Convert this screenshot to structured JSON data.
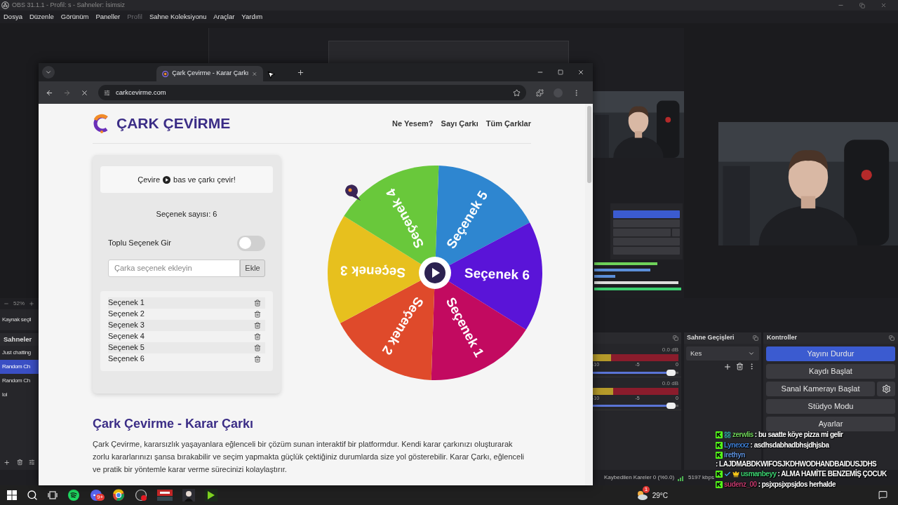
{
  "obs": {
    "title": "OBS 31.1.1 - Profil: s - Sahneler: İsimsiz",
    "menu": [
      {
        "label": "Dosya",
        "disabled": false
      },
      {
        "label": "Düzenle",
        "disabled": false
      },
      {
        "label": "Görünüm",
        "disabled": false
      },
      {
        "label": "Paneller",
        "disabled": false
      },
      {
        "label": "Profil",
        "disabled": true
      },
      {
        "label": "Sahne Koleksiyonu",
        "disabled": false
      },
      {
        "label": "Araçlar",
        "disabled": false
      },
      {
        "label": "Yardım",
        "disabled": false
      }
    ],
    "zoom": "52%",
    "source_hint": "Kaynak seçil",
    "scenes": {
      "title": "Sahneler",
      "items": [
        {
          "label": "Just chatting",
          "selected": false
        },
        {
          "label": "Random Ch",
          "selected": true
        },
        {
          "label": "Random Ch",
          "selected": false
        },
        {
          "label": "lol",
          "selected": false
        }
      ]
    },
    "mixer": {
      "channels": [
        {
          "reading": "0.0 dB",
          "meter": {
            "level": 0.22
          },
          "level": 0.97,
          "ticks": [
            "-10",
            "-5",
            "0"
          ]
        },
        {
          "reading": "0.0 dB",
          "meter": {
            "level": 0.24
          },
          "level": 0.97,
          "ticks": [
            "-10",
            "-5",
            "0"
          ]
        }
      ]
    },
    "transitions": {
      "title": "Sahne Geçişleri",
      "value": "Kes"
    },
    "controls": {
      "title": "Kontroller",
      "buttons": [
        {
          "label": "Yayını Durdur",
          "active": true,
          "kind": "plain"
        },
        {
          "label": "Kaydı Başlat",
          "active": false,
          "kind": "plain"
        },
        {
          "label": "Sanal Kamerayı Başlat",
          "active": false,
          "kind": "settings"
        },
        {
          "label": "Stüdyo Modu",
          "active": false,
          "kind": "plain"
        },
        {
          "label": "Ayarlar",
          "active": false,
          "kind": "plain"
        }
      ]
    },
    "status_bar": {
      "dropped": "Kaybedilen Kareler 0 (%0.0)",
      "bitrate": "5197 kbps"
    }
  },
  "browser": {
    "tab_title": "Çark Çevirme - Karar Çarkı",
    "url": "carkcevirme.com"
  },
  "page": {
    "logo": "ÇARK ÇEVİRME",
    "nav": [
      "Ne Yesem?",
      "Sayı Çarkı",
      "Tüm Çarklar"
    ],
    "instruction_before": "Çevire",
    "instruction_after": "bas ve çarkı çevir!",
    "count": "Seçenek sayısı: 6",
    "bulk": {
      "label": "Toplu Seçenek Gir",
      "on": false
    },
    "input": {
      "placeholder": "Çarka seçenek ekleyin"
    },
    "add_button": "Ekle",
    "options": [
      "Seçenek 1",
      "Seçenek 2",
      "Seçenek 3",
      "Seçenek 4",
      "Seçenek 5",
      "Seçenek 6"
    ],
    "wheel": {
      "segments": [
        {
          "label": "Seçenek 5",
          "color": "#2e86d0"
        },
        {
          "label": "Seçenek 6",
          "color": "#5a14d8"
        },
        {
          "label": "Seçenek 1",
          "color": "#c20a60"
        },
        {
          "label": "Seçenek 2",
          "color": "#df4a2b"
        },
        {
          "label": "Seçenek 3",
          "color": "#e7c01e"
        },
        {
          "label": "Seçenek 4",
          "color": "#69c83b"
        }
      ]
    },
    "heading": "Çark Çevirme - Karar Çarkı",
    "paragraph": "Çark Çevirme, kararsızlık yaşayanlara eğlenceli bir çözüm sunan interaktif bir platformdur. Kendi karar çarkınızı oluşturarak zorlu kararlarınızı şansa bırakabilir ve seçim yapmakta güçlük çektiğiniz durumlarda size yol gösterebilir. Karar Çarkı, eğlenceli ve pratik bir yöntemle karar verme sürecinizi kolaylaştırır."
  },
  "chat": [
    {
      "name": "zerwlis",
      "color": "#6fd35a",
      "badges": [
        {
          "kind": "kick"
        },
        {
          "kind": "sub"
        }
      ],
      "message": ": bu saatte köye pizza mi gelir"
    },
    {
      "name": "Lynexxz",
      "color": "#3d7fd6",
      "badges": [
        {
          "kind": "kick"
        }
      ],
      "message": ": asdhsdabhadbhsjdhjsba"
    },
    {
      "name": "irethyn",
      "color": "#5b8ed8",
      "badges": [
        {
          "kind": "kick"
        }
      ],
      "message": ": LAJDMABDKWIFOSJKDHWODHANDBAIDUSJDHS"
    },
    {
      "name": "usmanbeyy",
      "color": "#3cd070",
      "badges": [
        {
          "kind": "kick"
        },
        {
          "kind": "verified"
        },
        {
          "kind": "crown"
        }
      ],
      "message": ": ALMA HAMİTE BENZEMİŞ ÇOCUK"
    },
    {
      "name": "sudenz_00",
      "color": "#c0396b",
      "badges": [
        {
          "kind": "kick"
        }
      ],
      "message": ": psjxpsjxpsjdos herhalde"
    }
  ],
  "taskbar": {
    "discord_badge": "9+",
    "weather_badge": "1",
    "temperature": "29°C"
  }
}
